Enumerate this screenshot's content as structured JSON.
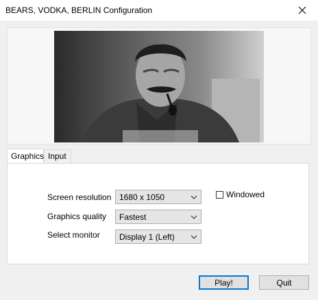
{
  "window": {
    "title": "BEARS, VODKA, BERLIN Configuration"
  },
  "icons": {
    "close": "close-icon",
    "dropdown": "chevron-down-icon"
  },
  "tabs": [
    {
      "label": "Graphics",
      "active": true
    },
    {
      "label": "Input",
      "active": false
    }
  ],
  "graphics": {
    "screen_resolution": {
      "label": "Screen resolution",
      "value": "1680 x 1050"
    },
    "graphics_quality": {
      "label": "Graphics quality",
      "value": "Fastest"
    },
    "select_monitor": {
      "label": "Select monitor",
      "value": "Display 1 (Left)"
    },
    "windowed": {
      "label": "Windowed",
      "checked": false
    }
  },
  "buttons": {
    "play": "Play!",
    "quit": "Quit"
  },
  "colors": {
    "window_bg": "#f0f0f0",
    "title_bg": "#ffffff",
    "primary_border": "#0078d7"
  }
}
